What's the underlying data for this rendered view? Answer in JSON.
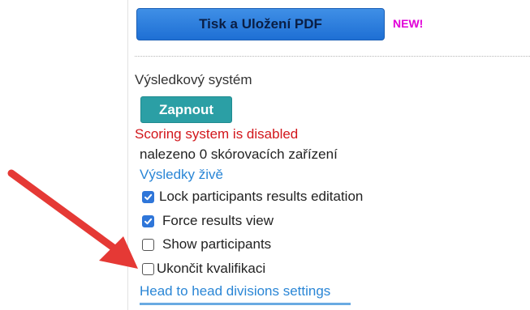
{
  "toolbar": {
    "print_label": "Tisk a Uložení PDF",
    "new_badge": "NEW!"
  },
  "scoring": {
    "title": "Výsledkový systém",
    "toggle_label": "Zapnout",
    "status": "Scoring system is disabled",
    "devices_found": "nalezeno 0 skórovacích zařízení",
    "live_results_link": "Výsledky živě"
  },
  "options": [
    {
      "label": "Lock participants results editation",
      "checked": true
    },
    {
      "label": "Force results view",
      "checked": true
    },
    {
      "label": "Show participants",
      "checked": false
    },
    {
      "label": "Ukončit kvalifikaci",
      "checked": false
    }
  ],
  "links": {
    "h2h_settings": "Head to head divisions settings"
  },
  "colors": {
    "primary_button": "#1e6fd4",
    "teal_button": "#2b9fa5",
    "error_text": "#d2161b",
    "link": "#2a86d6",
    "badge": "#e100d8",
    "arrow": "#e53935"
  },
  "icons": {
    "checked": "check-icon",
    "annotation": "red-arrow-annotation"
  }
}
